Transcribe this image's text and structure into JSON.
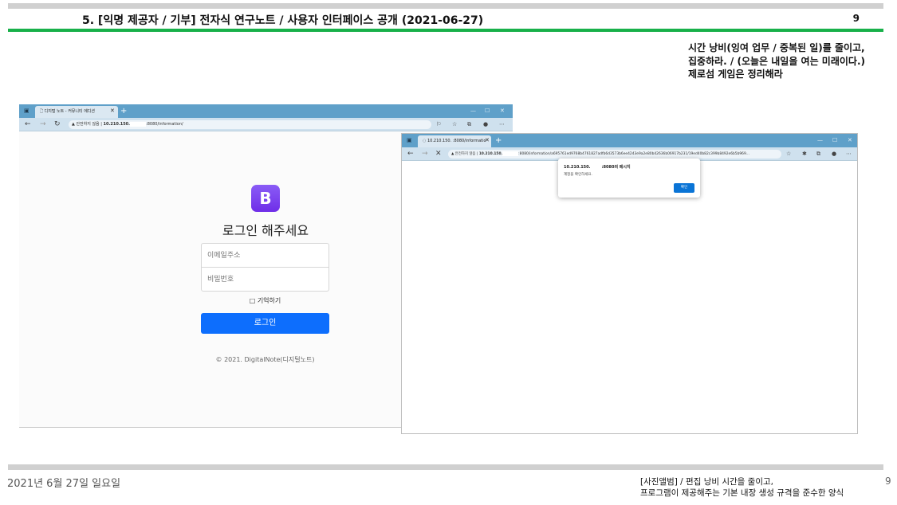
{
  "header": {
    "title": "5. [익명 제공자 / 기부] 전자식 연구노트 / 사용자 인터페이스 공개 (2021-06-27)",
    "page_number": "9"
  },
  "side_note": {
    "lines": [
      "시간 낭비(잉여 업무 / 중복된 일)를 줄이고,",
      "집중하라. / (오늘은 내일을 여는 미래이다.)",
      "제로섬 게임은 정리해라"
    ]
  },
  "browser1": {
    "tab_title": "디지털 노트 - 커뮤니티 에디션",
    "url_warning": "안전하지 않음",
    "url_host": "10.210.150.",
    "url_rest": ":8080/information/",
    "window_controls": [
      "—",
      "☐",
      "✕"
    ],
    "logo_letter": "B",
    "login_title": "로그인 해주세요",
    "email_placeholder": "이메일주소",
    "password_placeholder": "비밀번호",
    "remember_label": "□ 기억하기",
    "login_button": "로그인",
    "copyright": "© 2021. DigitalNote(디지털노트)"
  },
  "browser2": {
    "tab_title": "10.210.150.    :8080/informatio",
    "url_warning": "안전하지 않음",
    "url_host": "10.210.150.",
    "url_rest": ":8080/information/a695761ed9768b4761827adfb6d3573b6ee4243e9a2e80b42636b06917b231/19ed40b82c399b8492e6b5b969...",
    "window_controls": [
      "—",
      "☐",
      "✕"
    ],
    "dialog": {
      "title_host": "10.210.150.",
      "title_rest": ":8080의 메시지",
      "message": "계정을 확인하세요.",
      "ok_button": "확인"
    }
  },
  "footer": {
    "date": "2021년 6월 27일 일요일",
    "right_lines": [
      "[사진앨범] / 편집 낭비 시간을 줄이고,",
      "프로그램이 제공해주는 기본 내장 생성 규격을 준수한 양식"
    ],
    "page_number": "9"
  }
}
